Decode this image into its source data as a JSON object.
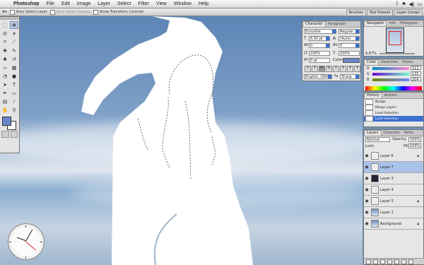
{
  "menubar": {
    "apple": "",
    "items": [
      "Photoshop",
      "File",
      "Edit",
      "Image",
      "Layer",
      "Select",
      "Filter",
      "View",
      "Window",
      "Help"
    ],
    "status_icons": [
      "bluetooth-icon",
      "flag-icon",
      "volume-icon",
      "battery-icon"
    ]
  },
  "optionsbar": {
    "auto_select_layer": "Auto Select Layer",
    "auto_select_groups": "Auto Select Groups",
    "show_transform": "Show Transform Controls",
    "wells": [
      "Brushes",
      "Tool Presets",
      "Layer Comps"
    ]
  },
  "character": {
    "tabs": [
      "Character",
      "Paragraph"
    ],
    "font_family": "Eurostile",
    "font_style": "Regular",
    "font_size": "6.00 pt",
    "leading": "(Auto)",
    "tracking_a": "0",
    "tracking_b": "0",
    "vscale": "100%",
    "hscale": "100%",
    "baseline": "0 pt",
    "color_label": "Color:",
    "style_buttons": [
      "T",
      "T",
      "TT",
      "Tr",
      "T",
      "T",
      "T",
      "T"
    ],
    "language": "English: USA",
    "aa": "Sharp"
  },
  "navigator": {
    "tabs": [
      "Navigator",
      "Info",
      "Histogram"
    ],
    "zoom": "6.67%"
  },
  "color": {
    "tabs": [
      "Color",
      "Swatches",
      "Styles"
    ],
    "r_label": "R",
    "g_label": "G",
    "b_label": "B",
    "r": "111",
    "g": "135",
    "b": "204"
  },
  "history": {
    "tabs": [
      "History",
      "Actions"
    ],
    "rows": [
      "Nudge",
      "Merge Layers",
      "Load Selection",
      "Load Selection"
    ],
    "selected_index": 3
  },
  "layers": {
    "tabs": [
      "Layers",
      "Channels",
      "Paths"
    ],
    "blend_mode": "Normal",
    "opacity_label": "Opacity:",
    "opacity": "100%",
    "lock_label": "Lock:",
    "fill_label": "Fill:",
    "fill": "100%",
    "rows": [
      {
        "name": "Layer 6",
        "visible": true,
        "thumb": "checker",
        "locked": true
      },
      {
        "name": "Layer 7",
        "visible": true,
        "thumb": "checker",
        "locked": false
      },
      {
        "name": "Layer 3",
        "visible": true,
        "thumb": "dark",
        "locked": false
      },
      {
        "name": "Layer 4",
        "visible": true,
        "thumb": "checker",
        "locked": false
      },
      {
        "name": "Layer 5",
        "visible": true,
        "thumb": "checker",
        "locked": true
      },
      {
        "name": "Layer 1",
        "visible": true,
        "thumb": "photo",
        "locked": false
      },
      {
        "name": "Background",
        "visible": true,
        "thumb": "photo",
        "locked": true
      }
    ],
    "selected_index": 1
  },
  "colors": {
    "accent": "#3b6fd1",
    "foreground": "#6b87c9",
    "background": "#ffffff"
  }
}
